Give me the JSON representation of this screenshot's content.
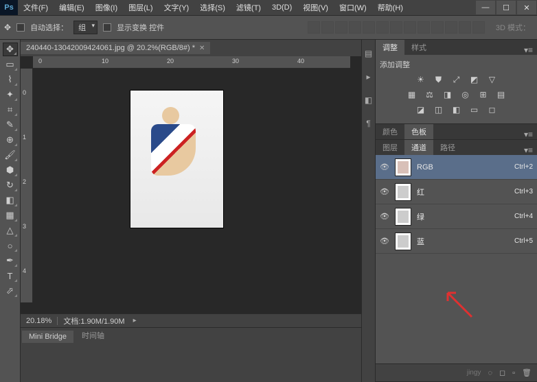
{
  "menu": [
    "文件(F)",
    "编辑(E)",
    "图像(I)",
    "图层(L)",
    "文字(Y)",
    "选择(S)",
    "滤镜(T)",
    "3D(D)",
    "视图(V)",
    "窗口(W)",
    "帮助(H)"
  ],
  "optbar": {
    "auto_select": "自动选择：",
    "group": "组",
    "show_transform": "显示变换 控件",
    "mode3d": "3D 模式："
  },
  "doc": {
    "tab": "240440-13042009424061.jpg @ 20.2%(RGB/8#) *",
    "zoom": "20.18%",
    "info": "文档:1.90M/1.90M"
  },
  "ruler_h": [
    "0",
    "10",
    "20",
    "30",
    "40"
  ],
  "ruler_v": [
    "0",
    "1",
    "2",
    "3",
    "4"
  ],
  "bottom_tabs": [
    "Mini Bridge",
    "时间轴"
  ],
  "panels": {
    "adjust": {
      "tabs": [
        "调整",
        "样式"
      ],
      "title": "添加调整"
    },
    "color": {
      "tabs": [
        "颜色",
        "色板"
      ]
    },
    "channels": {
      "tabs": [
        "图层",
        "通道",
        "路径"
      ],
      "items": [
        {
          "name": "RGB",
          "key": "Ctrl+2",
          "color": "#d8c0b8"
        },
        {
          "name": "红",
          "key": "Ctrl+3",
          "color": "#ccc"
        },
        {
          "name": "绿",
          "key": "Ctrl+4",
          "color": "#ccc"
        },
        {
          "name": "蓝",
          "key": "Ctrl+5",
          "color": "#ccc"
        }
      ]
    }
  },
  "watermark": "jingy"
}
